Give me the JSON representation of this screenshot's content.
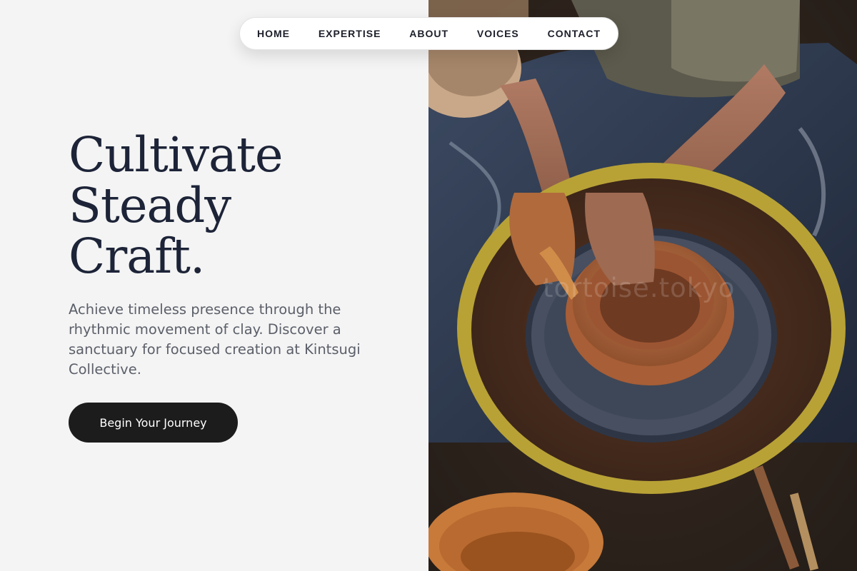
{
  "nav": {
    "items": [
      "HOME",
      "EXPERTISE",
      "ABOUT",
      "VOICES",
      "CONTACT"
    ]
  },
  "hero": {
    "title_lines": [
      "Cultivate",
      "Steady",
      "Craft."
    ],
    "subtitle": "Achieve timeless presence through the rhythmic movement of clay. Discover a sanctuary for focused creation at Kintsugi Collective.",
    "cta_label": "Begin Your Journey"
  },
  "image": {
    "watermark": "tortoise.tokyo"
  },
  "colors": {
    "background": "#f4f4f4",
    "title": "#1d2438",
    "body_text": "#5b5f69",
    "button": "#1c1c1c",
    "button_text": "#ffffff"
  }
}
